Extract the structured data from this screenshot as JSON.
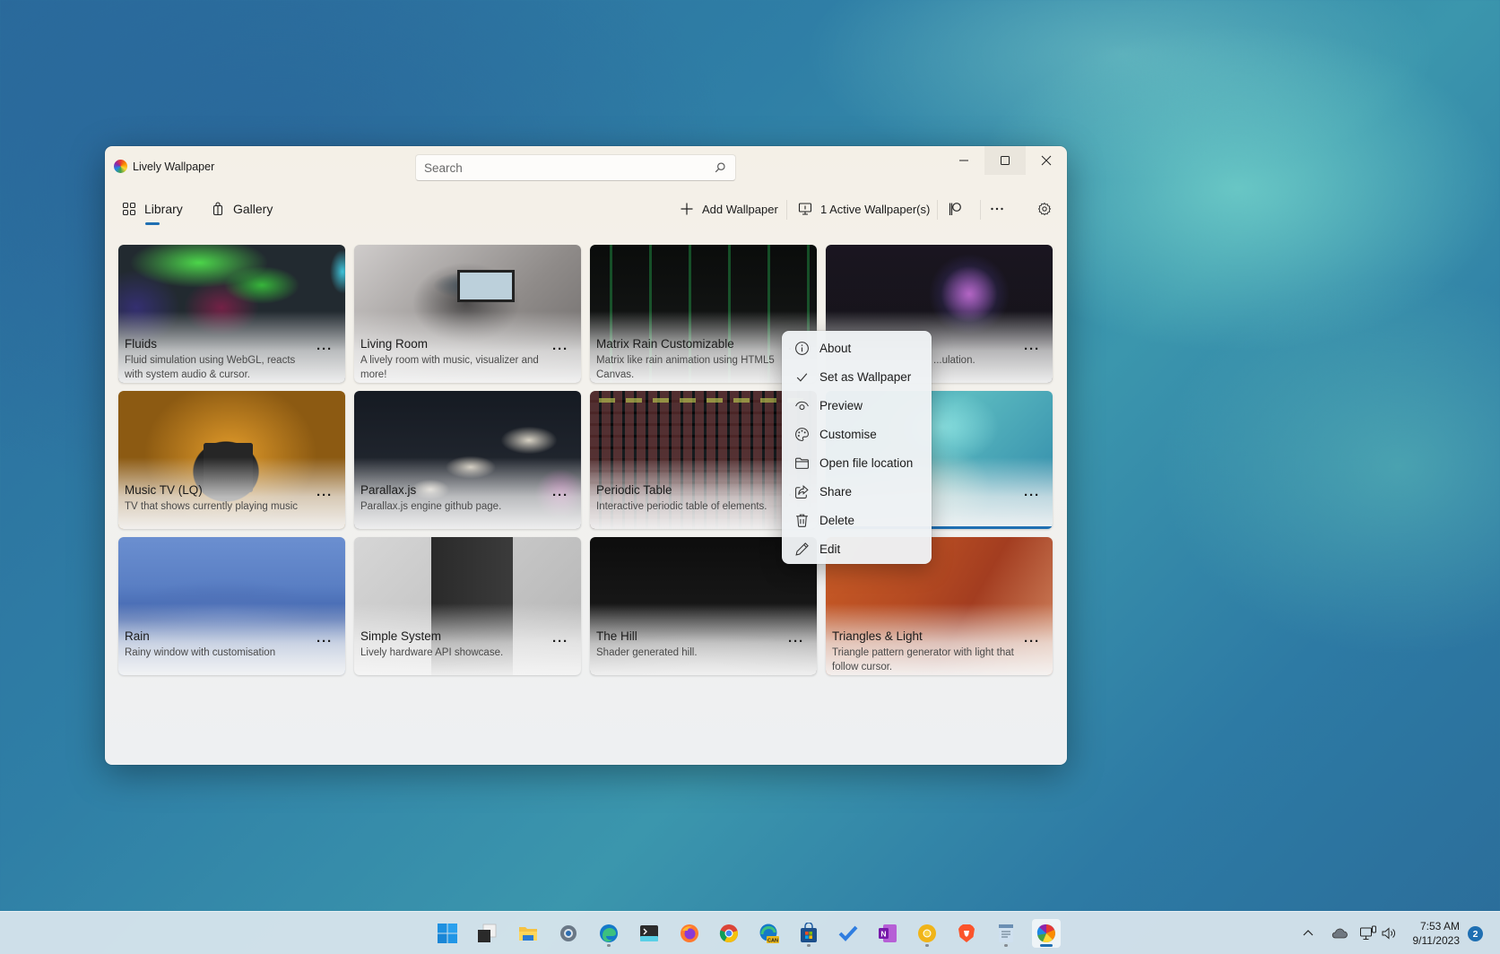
{
  "window": {
    "title": "Lively Wallpaper",
    "search": {
      "placeholder": "Search",
      "value": ""
    }
  },
  "nav": {
    "tabs": [
      {
        "label": "Library",
        "icon": "grid-icon",
        "selected": true
      },
      {
        "label": "Gallery",
        "icon": "shopping-bag-icon",
        "selected": false
      }
    ]
  },
  "toolbar": {
    "add_label": "Add Wallpaper",
    "active_label": "1 Active Wallpaper(s)",
    "flag_icon": "flag-icon",
    "more_icon": "more-horizontal-icon",
    "settings_icon": "gear-icon"
  },
  "library": {
    "cards": [
      {
        "title": "Fluids",
        "description": "Fluid simulation using WebGL, reacts with system audio & cursor."
      },
      {
        "title": "Living Room",
        "description": "A lively room with music, visualizer and more!"
      },
      {
        "title": "Matrix Rain Customizable",
        "description": "Matrix like rain animation using HTML5 Canvas."
      },
      {
        "title": "",
        "description": "...ulation."
      },
      {
        "title": "Music TV (LQ)",
        "description": "TV that shows currently playing music"
      },
      {
        "title": "Parallax.js",
        "description": "Parallax.js engine github page."
      },
      {
        "title": "Periodic Table",
        "description": "Interactive periodic table of elements."
      },
      {
        "title": "",
        "description": "",
        "selected": true
      },
      {
        "title": "Rain",
        "description": "Rainy window with customisation"
      },
      {
        "title": "Simple System",
        "description": "Lively hardware API showcase."
      },
      {
        "title": "The Hill",
        "description": "Shader generated hill."
      },
      {
        "title": "Triangles & Light",
        "description": "Triangle pattern generator with light that follow cursor."
      }
    ]
  },
  "context_menu": {
    "items": [
      {
        "label": "About",
        "icon": "info-icon"
      },
      {
        "label": "Set as Wallpaper",
        "icon": "checkmark-icon"
      },
      {
        "label": "Preview",
        "icon": "eye-icon"
      },
      {
        "label": "Customise",
        "icon": "palette-icon"
      },
      {
        "label": "Open file location",
        "icon": "folder-icon"
      },
      {
        "label": "Share",
        "icon": "share-icon"
      },
      {
        "label": "Delete",
        "icon": "trash-icon"
      },
      {
        "label": "Edit",
        "icon": "pencil-icon"
      }
    ]
  },
  "taskbar": {
    "icons": [
      "windows-start-icon",
      "task-view-icon",
      "file-explorer-icon",
      "settings-icon",
      "edge-icon",
      "terminal-icon",
      "firefox-icon",
      "chrome-icon",
      "edge-canary-icon",
      "store-icon",
      "todo-icon",
      "onenote-icon",
      "chrome-canary-icon",
      "brave-icon",
      "notepad-icon",
      "lively-wallpaper-icon"
    ],
    "tray": {
      "time": "7:53 AM",
      "date": "9/11/2023",
      "notification_count": "2"
    }
  },
  "colors": {
    "accent": "#1f6fb2"
  }
}
